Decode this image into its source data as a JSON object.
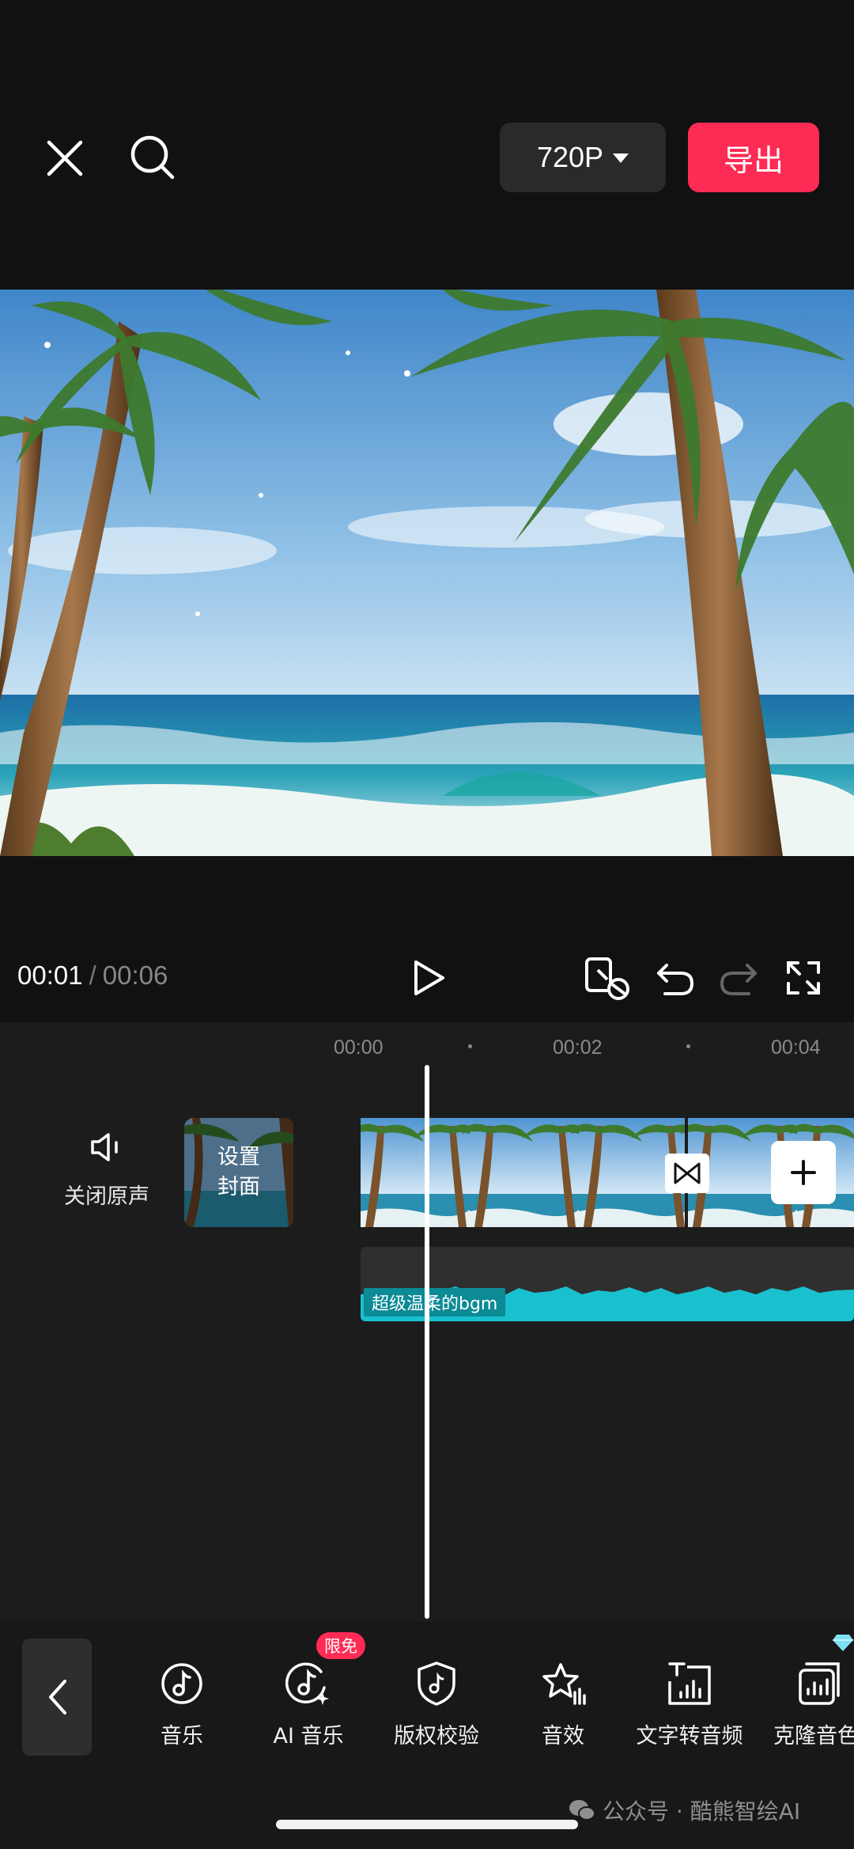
{
  "header": {
    "resolution": "720P",
    "export_label": "导出"
  },
  "player": {
    "current_time": "00:01",
    "separator": "/",
    "total_time": "00:06"
  },
  "ruler": {
    "ticks": [
      "00:00",
      "00:02",
      "00:04"
    ]
  },
  "tracks": {
    "mute_label": "关闭原声",
    "cover_label": "设置\n封面",
    "audio_label": "超级温柔的bgm"
  },
  "toolbar": {
    "items": [
      {
        "label": "音乐",
        "icon": "music-note-icon"
      },
      {
        "label": "AI 音乐",
        "icon": "ai-music-icon"
      },
      {
        "label": "版权校验",
        "icon": "copyright-shield-icon"
      },
      {
        "label": "音效",
        "icon": "sound-effect-star-icon"
      },
      {
        "label": "文字转音频",
        "icon": "text-to-audio-icon"
      },
      {
        "label": "克隆音色",
        "icon": "clone-voice-icon"
      }
    ],
    "badge": "限免"
  },
  "watermark": "公众号 · 酷熊智绘AI",
  "colors": {
    "accent": "#fe2c55",
    "audio": "#19c1cf",
    "background": "#121212"
  }
}
